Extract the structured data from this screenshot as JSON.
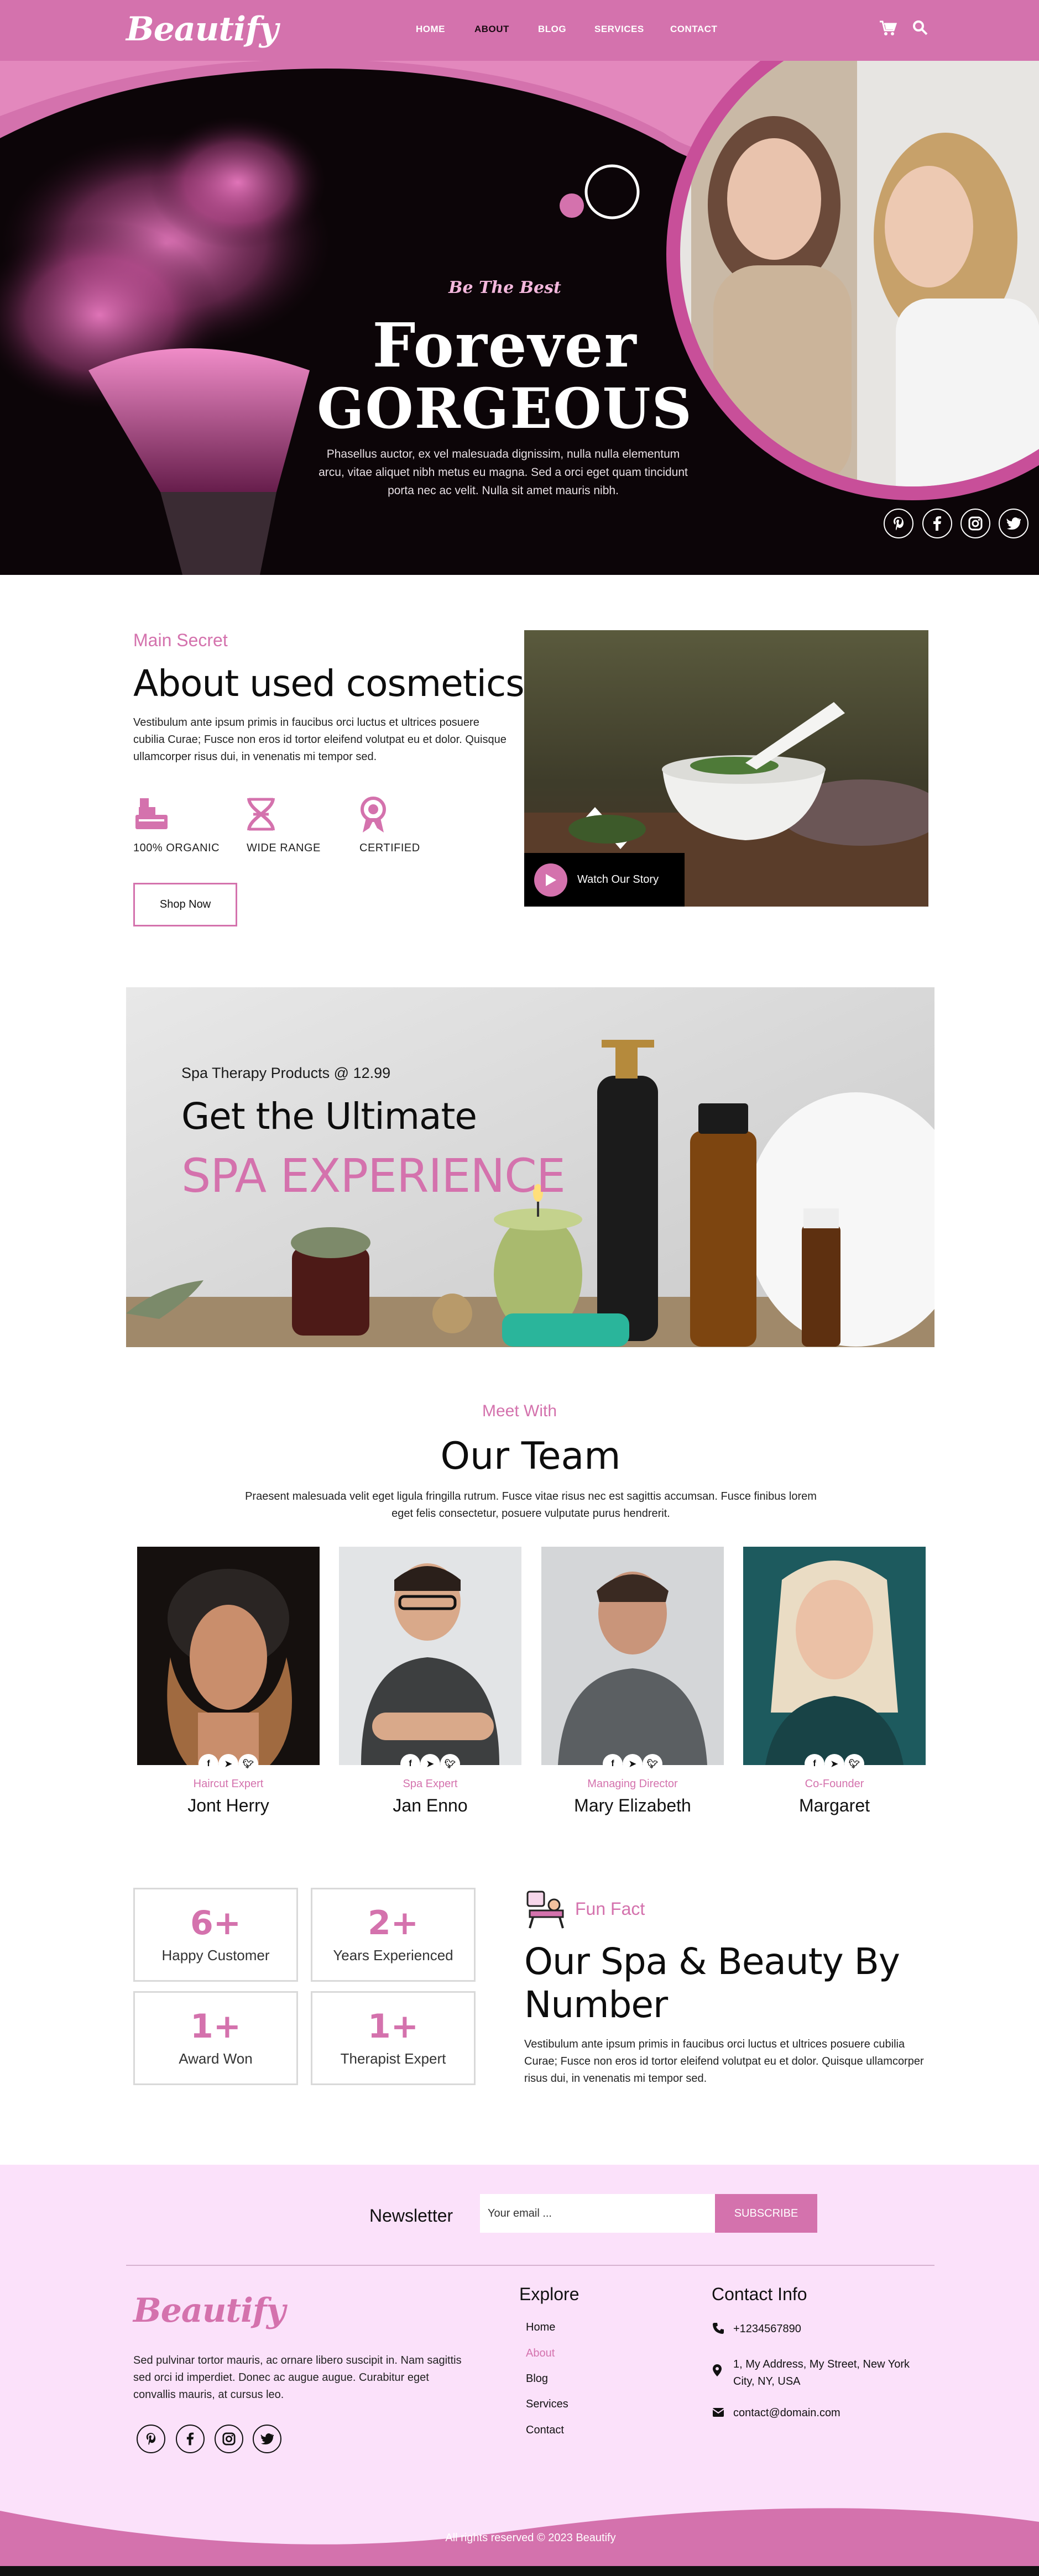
{
  "brand": {
    "logo": "Beautify",
    "accent": "#d472ad"
  },
  "nav": {
    "items": [
      "HOME",
      "ABOUT",
      "BLOG",
      "SERVICES",
      "CONTACT"
    ],
    "active": "ABOUT",
    "icons": [
      "cart-icon",
      "search-icon"
    ]
  },
  "hero": {
    "kicker": "Be The Best",
    "title_line1": "Forever",
    "title_line2": "GORGEOUS",
    "description": "Phasellus auctor, ex vel malesuada dignissim, nulla nulla elementum arcu, vitae aliquet nibh metus eu magna. Sed a orci eget quam tincidunt porta nec ac velit. Nulla sit amet mauris nibh.",
    "social": [
      "pinterest-icon",
      "facebook-icon",
      "instagram-icon",
      "twitter-icon"
    ]
  },
  "about": {
    "kicker": "Main Secret",
    "title": "About used cosmetics",
    "description": "Vestibulum ante ipsum primis in faucibus orci luctus et ultrices posuere cubilia Curae; Fusce non eros id tortor eleifend volutpat eu et dolor. Quisque ullamcorper risus dui, in venenatis mi tempor sed.",
    "features": [
      {
        "label": "100% ORGANIC",
        "icon": "organic-icon"
      },
      {
        "label": "WIDE RANGE",
        "icon": "dna-icon"
      },
      {
        "label": "CERTIFIED",
        "icon": "ribbon-icon"
      }
    ],
    "shop_button": "Shop Now",
    "watch_label": "Watch Our Story"
  },
  "spa": {
    "small": "Spa Therapy Products @ 12.99",
    "title1": "Get the Ultimate",
    "title2": "SPA EXPERIENCE"
  },
  "team": {
    "kicker": "Meet With",
    "title": "Our Team",
    "description": "Praesent malesuada velit eget ligula fringilla rutrum. Fusce vitae risus nec est sagittis accumsan. Fusce finibus lorem eget felis consectetur, posuere vulputate purus hendrerit.",
    "members": [
      {
        "role": "Haircut Expert",
        "name": "Jont Herry"
      },
      {
        "role": "Spa Expert",
        "name": "Jan Enno"
      },
      {
        "role": "Managing Director",
        "name": "Mary Elizabeth"
      },
      {
        "role": "Co-Founder",
        "name": "Margaret"
      }
    ]
  },
  "stats": [
    {
      "num": "6+",
      "label": "Happy Customer"
    },
    {
      "num": "2+",
      "label": "Years Experienced"
    },
    {
      "num": "1+",
      "label": "Award Won"
    },
    {
      "num": "1+",
      "label": "Therapist Expert"
    }
  ],
  "fun": {
    "kicker": "Fun Fact",
    "title": "Our Spa & Beauty By Number",
    "description": "Vestibulum ante ipsum primis in faucibus orci luctus et ultrices posuere cubilia Curae; Fusce non eros id tortor eleifend volutpat eu et dolor. Quisque ullamcorper risus dui, in venenatis mi tempor sed."
  },
  "newsletter": {
    "label": "Newsletter",
    "placeholder": "Your email ...",
    "button": "SUBSCRIBE"
  },
  "footer": {
    "logo": "Beautify",
    "description": "Sed pulvinar tortor mauris, ac ornare libero suscipit in. Nam sagittis sed orci id imperdiet. Donec ac augue augue. Curabitur eget convallis mauris, at cursus leo.",
    "explore_title": "Explore",
    "links": [
      "Home",
      "About",
      "Blog",
      "Services",
      "Contact"
    ],
    "contact_title": "Contact Info",
    "phone": "+1234567890",
    "address": "1, My Address, My Street, New York City, NY, USA",
    "email": "contact@domain.com",
    "copyright": "All rights reserved © 2023 Beautify"
  }
}
